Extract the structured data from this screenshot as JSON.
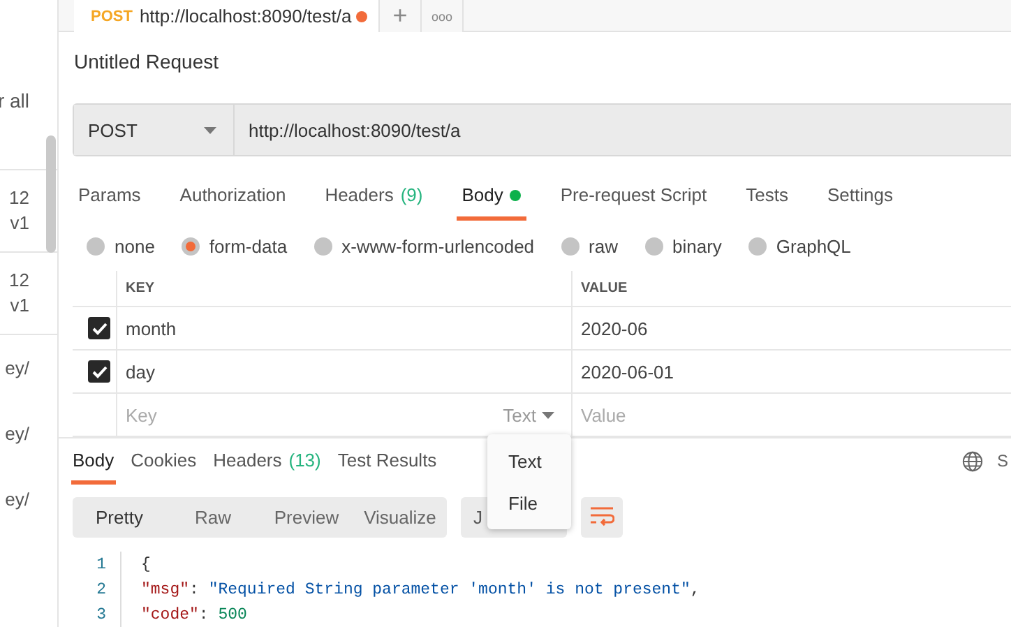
{
  "sidebar": {
    "filter_text": "r all",
    "items": [
      {
        "lines": [
          "12",
          "v1"
        ]
      },
      {
        "lines": [
          "12",
          "v1"
        ]
      },
      {
        "lines": [
          "ey/"
        ]
      },
      {
        "lines": [
          "ey/"
        ]
      },
      {
        "lines": [
          "ey/"
        ]
      }
    ]
  },
  "request_tab": {
    "method": "POST",
    "url": "http://localhost:8090/test/a",
    "unsaved": true
  },
  "tab_bar_buttons": [
    "+",
    "ooo"
  ],
  "title": "Untitled Request",
  "url_bar": {
    "method": "POST",
    "url": "http://localhost:8090/test/a"
  },
  "request_tabs": [
    {
      "label": "Params",
      "selected": false
    },
    {
      "label": "Authorization",
      "selected": false
    },
    {
      "label": "Headers",
      "count": "(9)",
      "selected": false
    },
    {
      "label": "Body",
      "dot": true,
      "selected": true
    },
    {
      "label": "Pre-request Script",
      "selected": false
    },
    {
      "label": "Tests",
      "selected": false
    },
    {
      "label": "Settings",
      "selected": false
    }
  ],
  "body_types": [
    {
      "label": "none",
      "selected": false
    },
    {
      "label": "form-data",
      "selected": true
    },
    {
      "label": "x-www-form-urlencoded",
      "selected": false
    },
    {
      "label": "raw",
      "selected": false
    },
    {
      "label": "binary",
      "selected": false
    },
    {
      "label": "GraphQL",
      "selected": false
    }
  ],
  "params_table": {
    "columns": [
      "KEY",
      "VALUE"
    ],
    "rows": [
      {
        "checked": true,
        "key": "month",
        "value": "2020-06"
      },
      {
        "checked": true,
        "key": "day",
        "value": "2020-06-01"
      }
    ],
    "new_row": {
      "key_placeholder": "Key",
      "type": "Text",
      "value_placeholder": "Value"
    }
  },
  "type_menu": [
    "Text",
    "File"
  ],
  "response_tabs": [
    {
      "label": "Body",
      "selected": true
    },
    {
      "label": "Cookies",
      "selected": false
    },
    {
      "label": "Headers",
      "count": "(13)",
      "selected": false
    },
    {
      "label": "Test Results",
      "selected": false
    }
  ],
  "response_status": "S",
  "view_modes": [
    {
      "label": "Pretty",
      "selected": true
    },
    {
      "label": "Raw",
      "selected": false
    },
    {
      "label": "Preview",
      "selected": false
    },
    {
      "label": "Visualize",
      "selected": false
    }
  ],
  "format": "J",
  "code_lines": [
    {
      "number": "1",
      "tokens": [
        {
          "kind": "punct",
          "text": "{"
        }
      ]
    },
    {
      "number": "2",
      "tokens": [
        {
          "kind": "key",
          "text": "\"msg\""
        },
        {
          "kind": "punct",
          "text": ": "
        },
        {
          "kind": "string",
          "text": "\"Required String parameter 'month' is not present\""
        },
        {
          "kind": "punct",
          "text": ","
        }
      ]
    },
    {
      "number": "3",
      "tokens": [
        {
          "kind": "key",
          "text": "\"code\""
        },
        {
          "kind": "punct",
          "text": ": "
        },
        {
          "kind": "number",
          "text": "500"
        }
      ]
    }
  ]
}
